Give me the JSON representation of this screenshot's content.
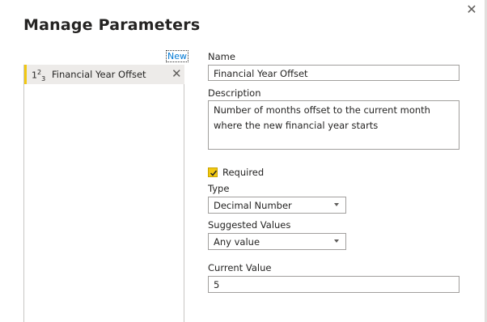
{
  "dialog": {
    "title": "Manage Parameters",
    "close_icon": "close-icon",
    "new_label": "New"
  },
  "parameters": [
    {
      "type_icon": "decimal-number-icon",
      "name": "Financial Year Offset",
      "delete_icon": "delete-icon"
    }
  ],
  "form": {
    "name_label": "Name",
    "name_value": "Financial Year Offset",
    "description_label": "Description",
    "description_value": "Number of months offset to the current month where the new financial year starts",
    "required_label": "Required",
    "required_checked": true,
    "type_label": "Type",
    "type_value": "Decimal Number",
    "suggested_label": "Suggested Values",
    "suggested_value": "Any value",
    "current_label": "Current Value",
    "current_value": "5"
  },
  "colors": {
    "accent": "#f2c811",
    "link": "#0078d4",
    "selected_bg": "#edebe9"
  }
}
